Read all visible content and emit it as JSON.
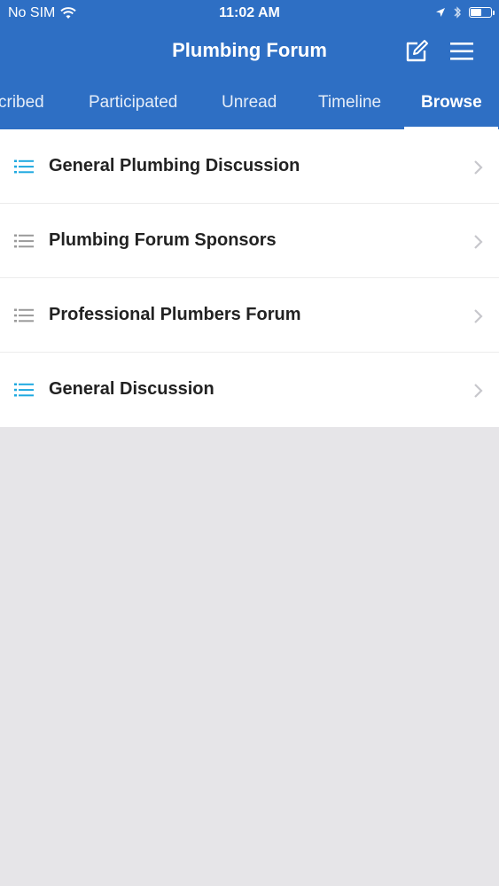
{
  "status_bar": {
    "carrier": "No SIM",
    "time": "11:02 AM",
    "battery_level": 0.55
  },
  "nav": {
    "title": "Plumbing Forum",
    "compose_icon": "compose-icon",
    "menu_icon": "hamburger-menu-icon"
  },
  "tabs": [
    {
      "label": "Subscribed",
      "visible_label": "cribed",
      "active": false
    },
    {
      "label": "Participated",
      "active": false
    },
    {
      "label": "Unread",
      "active": false
    },
    {
      "label": "Timeline",
      "active": false
    },
    {
      "label": "Browse",
      "active": true
    }
  ],
  "forums": [
    {
      "label": "General Plumbing Discussion",
      "icon": "list-icon",
      "icon_color": "#1fa9e0"
    },
    {
      "label": "Plumbing Forum Sponsors",
      "icon": "list-icon",
      "icon_color": "#9a9a9a"
    },
    {
      "label": "Professional Plumbers Forum",
      "icon": "list-icon",
      "icon_color": "#9a9a9a"
    },
    {
      "label": "General Discussion",
      "icon": "list-icon",
      "icon_color": "#1fa9e0"
    }
  ],
  "colors": {
    "header_bg": "#2e6fc4",
    "accent": "#1fa9e0",
    "background": "#e6e5e8"
  }
}
